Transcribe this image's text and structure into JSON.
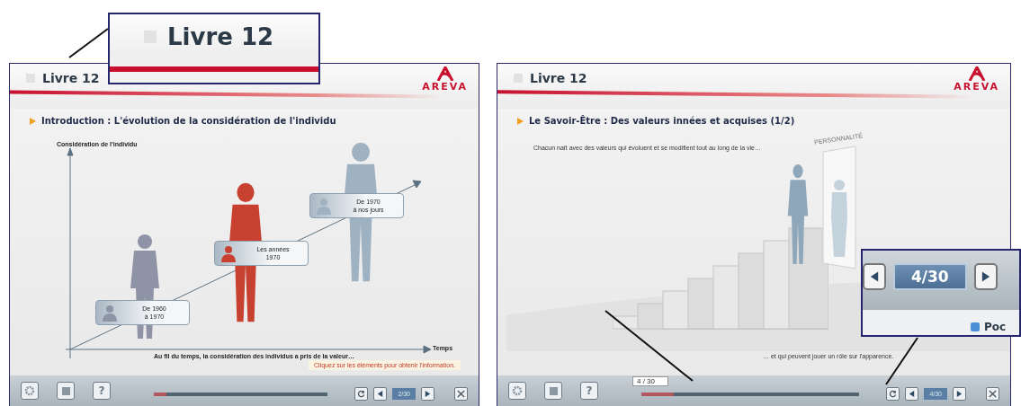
{
  "callouts": [
    {
      "kind": "title",
      "text": "Livre 12"
    },
    {
      "kind": "counter",
      "text": "4/30",
      "extra": "Poc"
    }
  ],
  "screens": [
    {
      "kind": "chart",
      "title": "Livre 12",
      "logo": "AREVA",
      "heading": "Introduction : L'évolution de la considération de l'individu",
      "y_axis": "Considération de l'individu",
      "x_axis": "Temps",
      "labels": [
        {
          "line1": "De 1960",
          "line2": "à 1970",
          "color": "#8e93a6"
        },
        {
          "line1": "Les années",
          "line2": "1970",
          "color": "#c8402f"
        },
        {
          "line1": "De 1970",
          "line2": "à nos jours",
          "color": "#9fb2c2"
        }
      ],
      "caption": "Au fil du temps, la considération des individus a pris de la valeur…",
      "hint": "Cliquez sur les éléments pour obtenir l'information.",
      "help": "?",
      "progress": {
        "level": 0.07
      },
      "counter": "2/30"
    },
    {
      "kind": "stairs",
      "title": "Livre 12",
      "logo": "AREVA",
      "heading": "Le Savoir-Être : Des valeurs innées et acquises (1/2)",
      "intro": "Chacun naît avec des valeurs qui évoluent et se modifient tout au long de la vie…",
      "mirror_label": "PERSONNALITÉ",
      "caption": "… et qui peuvent jouer un rôle sur l'apparence.",
      "help": "?",
      "progress": {
        "level": 0.15
      },
      "progress_tip": "4 / 30",
      "counter": "4/30"
    }
  ]
}
